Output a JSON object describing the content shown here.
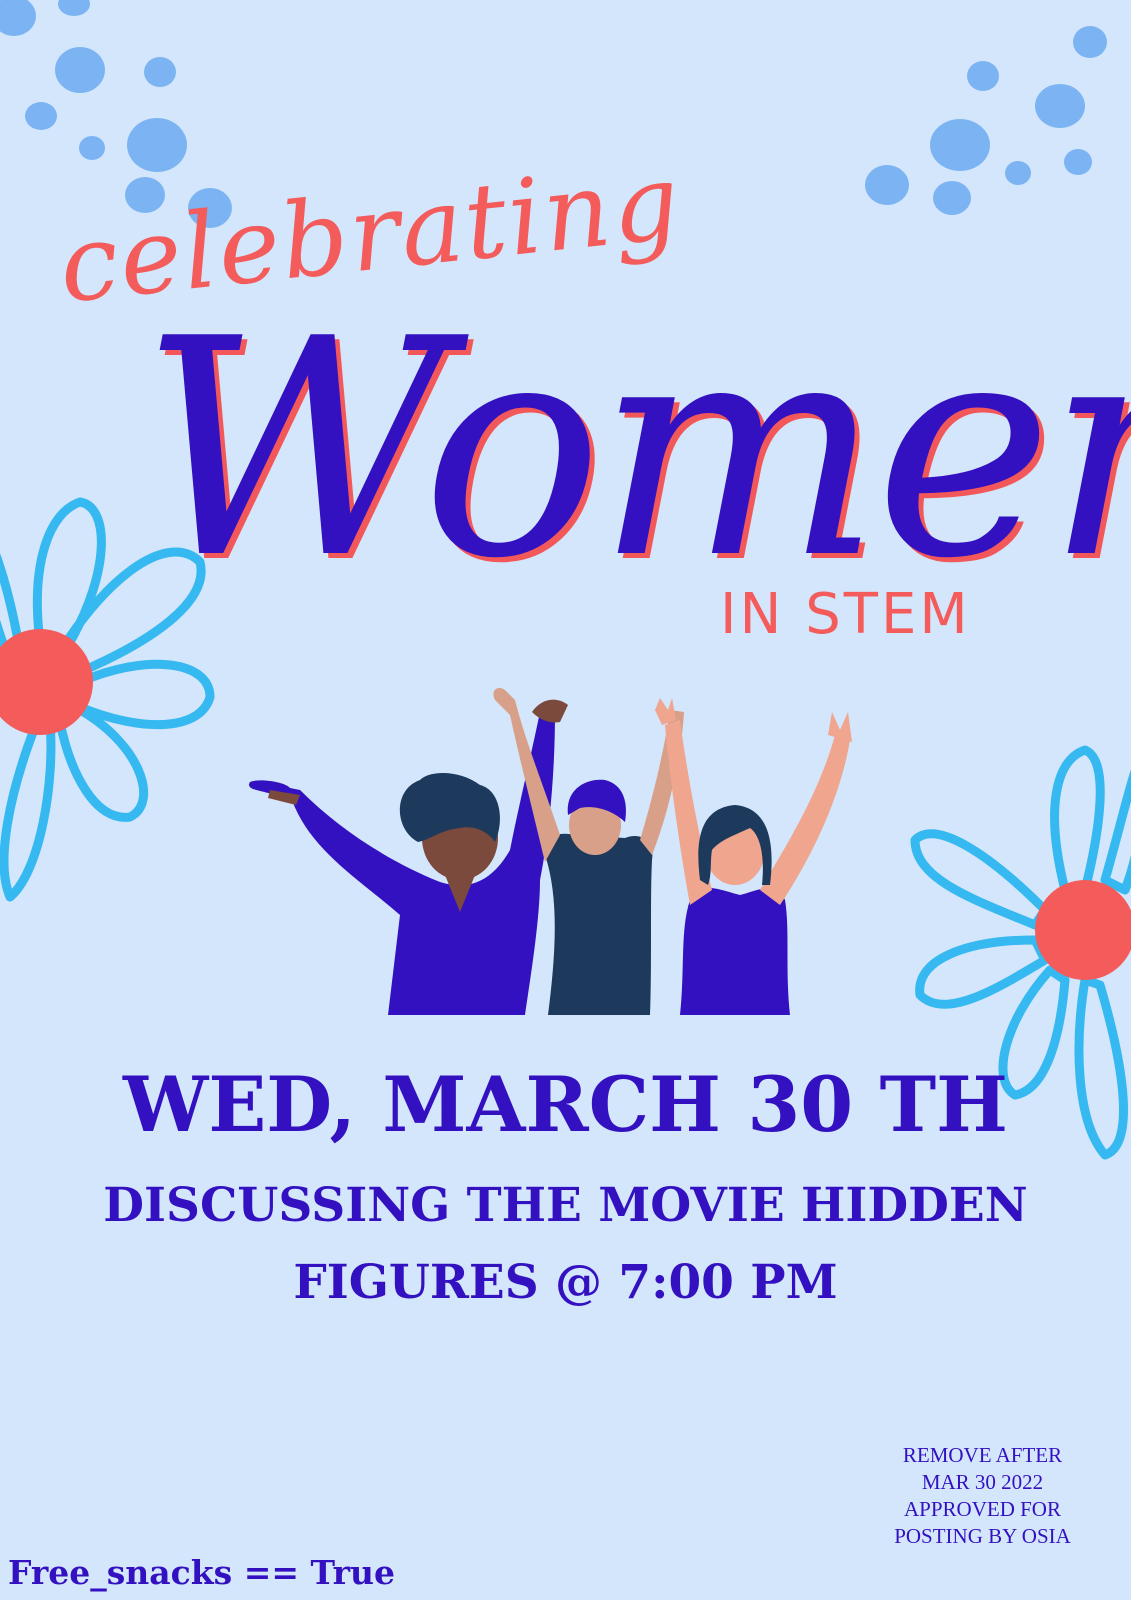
{
  "poster": {
    "script_word": "celebrating",
    "headline": "Women",
    "subheading": "IN STEM",
    "date": "WED, MARCH 30 TH",
    "description_line1": "DISCUSSING THE MOVIE HIDDEN",
    "description_line2": "FIGURES @ 7:00 PM",
    "notice_lines": [
      "REMOVE AFTER",
      "MAR 30 2022",
      "APPROVED FOR",
      "POSTING BY OSIA"
    ],
    "footer_code": "Free_snacks == True"
  },
  "colors": {
    "background": "#d3e6fb",
    "primary_purple": "#3311c0",
    "coral_red": "#f45b5b",
    "sky_blue": "#36b8f0",
    "dot_blue": "#7cb4f3",
    "navy": "#1d3a5c"
  },
  "icons": [
    "dot-cluster-top-left",
    "dot-cluster-top-right",
    "flower-left",
    "flower-right",
    "three-women-illustration"
  ]
}
